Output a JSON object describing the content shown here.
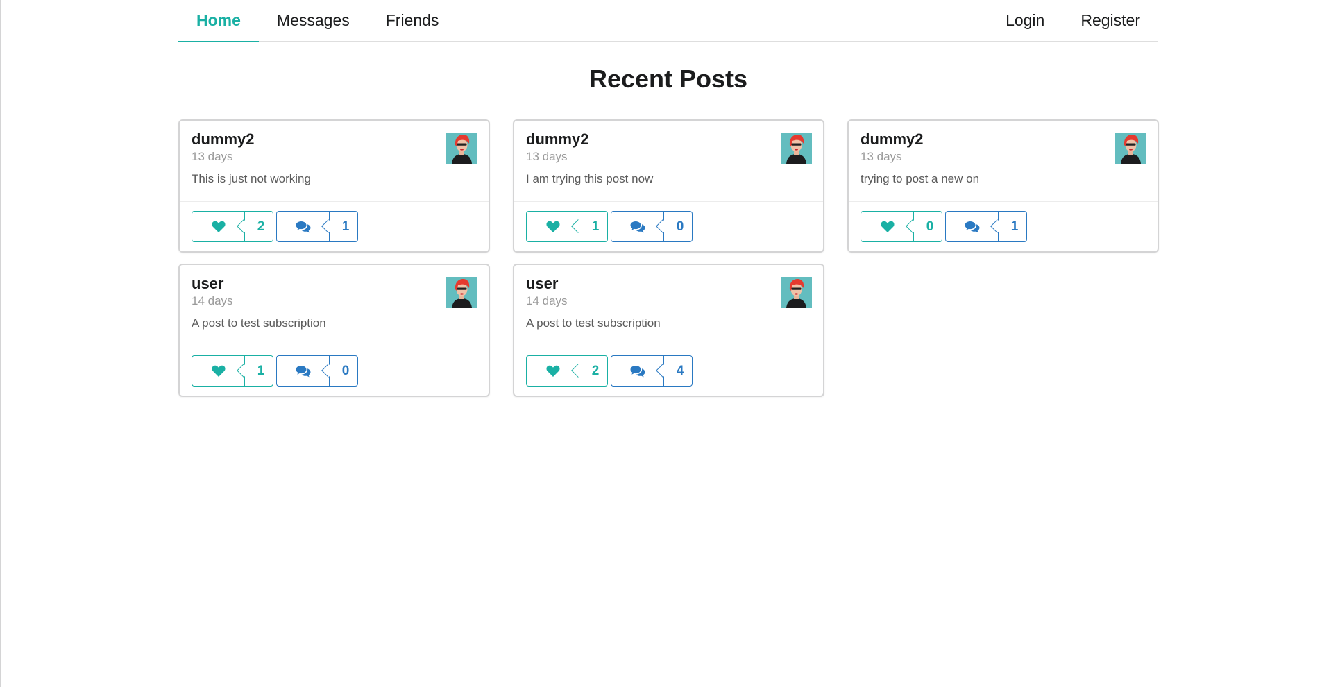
{
  "nav": {
    "left": [
      {
        "label": "Home",
        "active": true
      },
      {
        "label": "Messages",
        "active": false
      },
      {
        "label": "Friends",
        "active": false
      }
    ],
    "right": [
      {
        "label": "Login"
      },
      {
        "label": "Register"
      }
    ]
  },
  "page": {
    "title": "Recent Posts"
  },
  "colors": {
    "accent": "#1ab0a4",
    "comment_blue": "#2a79c2"
  },
  "posts": [
    {
      "author": "dummy2",
      "time": "13 days",
      "text": "This is just not working",
      "likes": "2",
      "comments": "1"
    },
    {
      "author": "dummy2",
      "time": "13 days",
      "text": "I am trying this post now",
      "likes": "1",
      "comments": "0"
    },
    {
      "author": "dummy2",
      "time": "13 days",
      "text": "trying to post a new on",
      "likes": "0",
      "comments": "1"
    },
    {
      "author": "user",
      "time": "14 days",
      "text": "A post to test subscription",
      "likes": "1",
      "comments": "0"
    },
    {
      "author": "user",
      "time": "14 days",
      "text": "A post to test subscription",
      "likes": "2",
      "comments": "4"
    }
  ],
  "icons": {
    "like": "heart-icon",
    "comment": "comments-icon",
    "avatar": "avatar-image"
  }
}
